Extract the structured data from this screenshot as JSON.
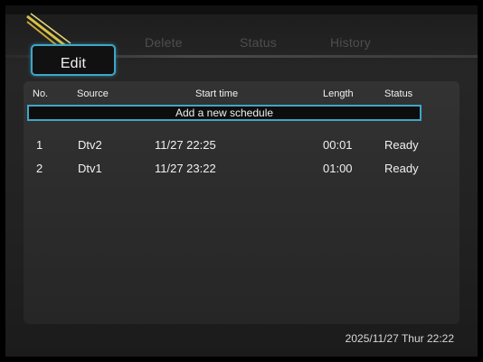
{
  "tabs": [
    {
      "label": "Edit",
      "active": true
    },
    {
      "label": "Delete",
      "active": false
    },
    {
      "label": "Status",
      "active": false
    },
    {
      "label": "History",
      "active": false
    }
  ],
  "table": {
    "headers": [
      "No.",
      "Source",
      "Start time",
      "Length",
      "Status"
    ],
    "add_label": "Add a new schedule",
    "rows": [
      {
        "no": "1",
        "source": "Dtv2",
        "start": "11/27 22:25",
        "length": "00:01",
        "status": "Ready"
      },
      {
        "no": "2",
        "source": "Dtv1",
        "start": "11/27 23:22",
        "length": "01:00",
        "status": "Ready"
      }
    ]
  },
  "clock": "2025/11/27 Thur 22:22",
  "colors": {
    "accent": "#3fa6c7",
    "background": "#222222"
  }
}
